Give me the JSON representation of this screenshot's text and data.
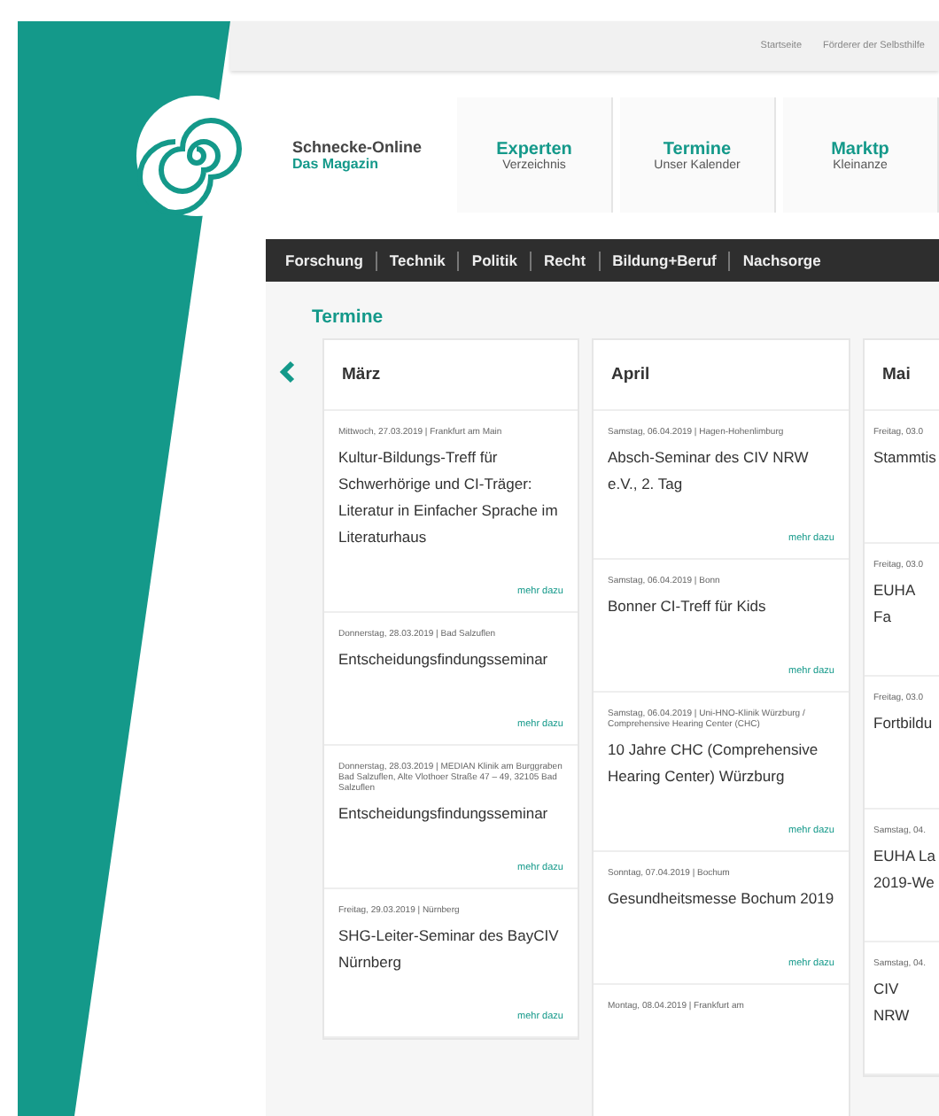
{
  "top_links": [
    "Startseite",
    "Förderer der Selbsthilfe"
  ],
  "brand": {
    "title": "Schnecke-Online",
    "subtitle": "Das Magazin"
  },
  "header_nav": [
    {
      "title": "Experten",
      "subtitle": "Verzeichnis"
    },
    {
      "title": "Termine",
      "subtitle": "Unser Kalender"
    },
    {
      "title": "Marktp",
      "subtitle": "Kleinanze"
    }
  ],
  "nav": [
    "Forschung",
    "Technik",
    "Politik",
    "Recht",
    "Bildung+Beruf",
    "Nachsorge"
  ],
  "section_title": "Termine",
  "months": [
    {
      "name": "März",
      "events": [
        {
          "meta": "Mittwoch, 27.03.2019 | Frankfurt am Main",
          "title": "Kultur-Bildungs-Treff für Schwerhörige und CI-Träger: Literatur in Einfacher Sprache im Literaturhaus",
          "link": "mehr dazu"
        },
        {
          "meta": "Donnerstag, 28.03.2019 | Bad Salzuflen",
          "title": "Entscheidungsfindungsseminar",
          "link": "mehr dazu"
        },
        {
          "meta": "Donnerstag, 28.03.2019 | MEDIAN Klinik am Burggraben Bad Salzuflen, Alte Vlothoer Straße 47 – 49, 32105 Bad Salzuflen",
          "title": "Entscheidungsfindungsseminar",
          "link": "mehr dazu"
        },
        {
          "meta": "Freitag, 29.03.2019 | Nürnberg",
          "title": "SHG-Leiter-Seminar des BayCIV Nürnberg",
          "link": "mehr dazu"
        }
      ]
    },
    {
      "name": "April",
      "events": [
        {
          "meta": "Samstag, 06.04.2019 | Hagen-Hohenlimburg",
          "title": "Absch-Seminar des CIV NRW e.V., 2. Tag",
          "link": "mehr dazu"
        },
        {
          "meta": "Samstag, 06.04.2019 | Bonn",
          "title": "Bonner CI-Treff für Kids",
          "link": "mehr dazu"
        },
        {
          "meta": "Samstag, 06.04.2019 | Uni-HNO-Klinik Würzburg / Comprehensive Hearing Center (CHC)",
          "title": "10 Jahre CHC (Comprehensive Hearing Center) Würzburg",
          "link": "mehr dazu"
        },
        {
          "meta": "Sonntag, 07.04.2019 | Bochum",
          "title": "Gesundheitsmesse Bochum 2019",
          "link": "mehr dazu"
        },
        {
          "meta": "Montag, 08.04.2019 | Frankfurt am"
        }
      ]
    },
    {
      "name": "Mai",
      "events": [
        {
          "meta": "Freitag, 03.0",
          "title": "Stammtis"
        },
        {
          "meta": "Freitag, 03.0",
          "title": "EUHA Fa"
        },
        {
          "meta": "Freitag, 03.0",
          "title": "Fortbildu"
        },
        {
          "meta": "Samstag, 04.",
          "title": "EUHA La 2019-We"
        },
        {
          "meta": "Samstag, 04.",
          "title": "CIV NRW"
        }
      ]
    }
  ]
}
